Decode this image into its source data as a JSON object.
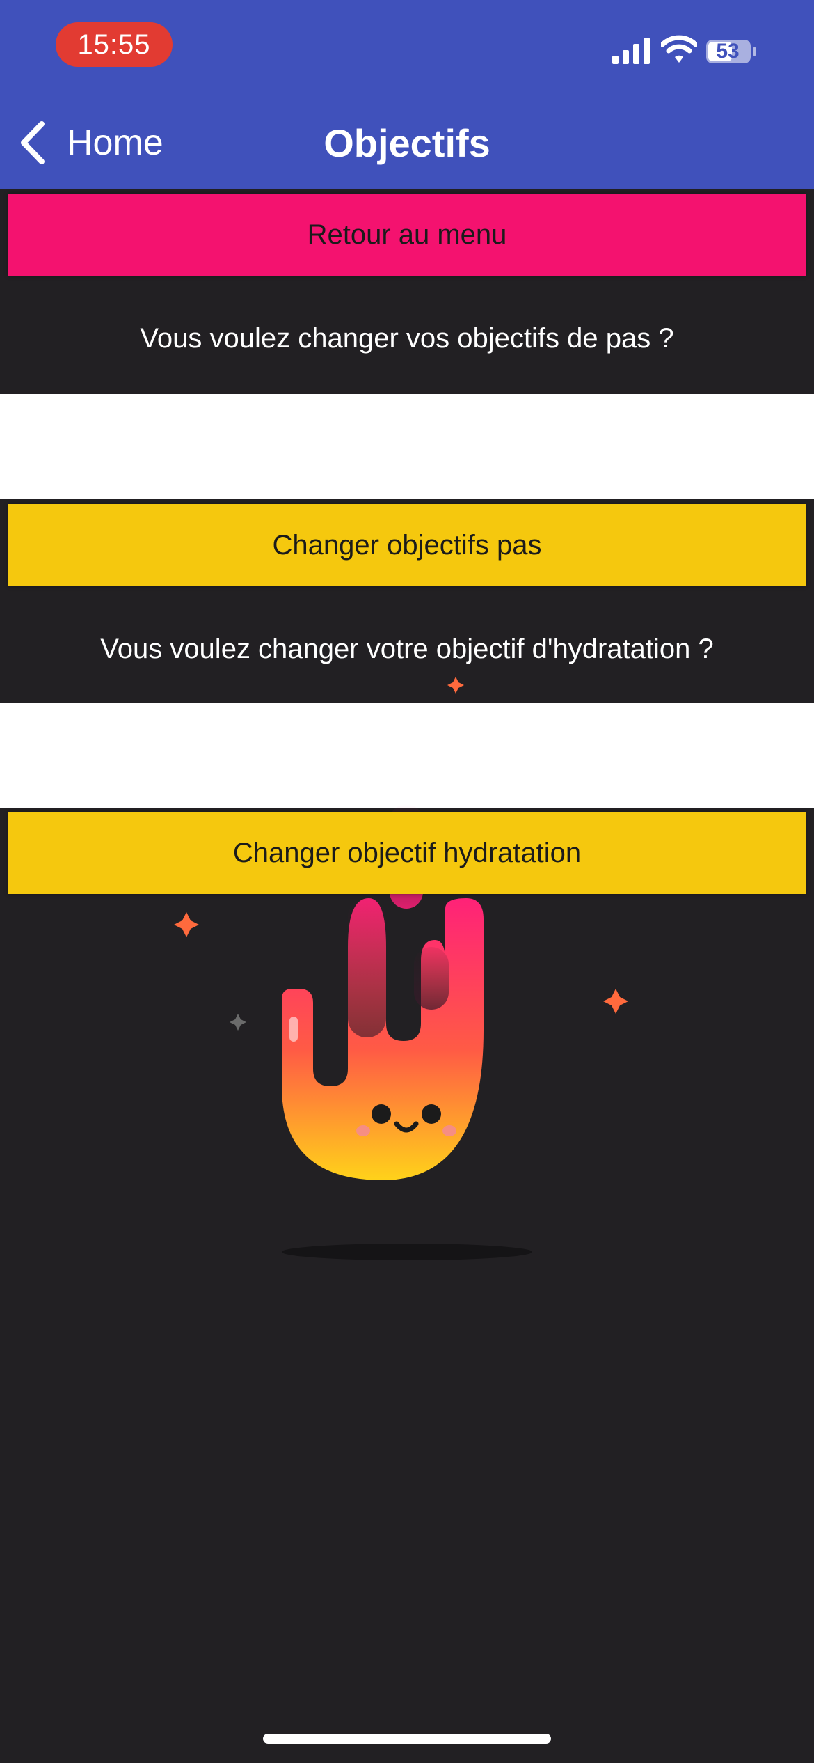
{
  "status_bar": {
    "time": "15:55",
    "battery": "53",
    "icons": [
      "signal-icon",
      "wifi-icon",
      "battery-icon"
    ]
  },
  "nav": {
    "back_label": "Home",
    "title": "Objectifs"
  },
  "buttons": {
    "menu": "Retour au menu",
    "steps": "Changer objectifs pas",
    "hydration": "Changer objectif hydratation"
  },
  "questions": {
    "steps": "Vous voulez changer vos objectifs de pas ?",
    "hydration": "Vous voulez changer votre objectif d'hydratation ?"
  },
  "colors": {
    "header": "#4051BB",
    "background": "#222023",
    "menu_button": "#F4126F",
    "action_button": "#F5C80E",
    "time_pill": "#E23B32"
  },
  "illustration": "flame-mascot"
}
